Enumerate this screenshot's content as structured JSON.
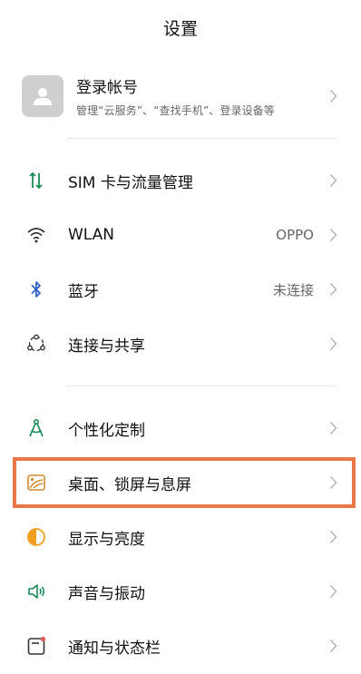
{
  "header": {
    "title": "设置"
  },
  "account": {
    "name": "登录帐号",
    "subtitle": "管理“云服务”、“查找手机”、登录设备等"
  },
  "groups": [
    [
      {
        "label": "SIM 卡与流量管理",
        "icon": "sim-icon"
      },
      {
        "label": "WLAN",
        "icon": "wifi-icon",
        "value": "OPPO"
      },
      {
        "label": "蓝牙",
        "icon": "bluetooth-icon",
        "value": "未连接"
      },
      {
        "label": "连接与共享",
        "icon": "share-icon"
      }
    ],
    [
      {
        "label": "个性化定制",
        "icon": "personalize-icon"
      },
      {
        "label": "桌面、锁屏与息屏",
        "icon": "wallpaper-icon",
        "highlighted": true
      },
      {
        "label": "显示与亮度",
        "icon": "brightness-icon"
      },
      {
        "label": "声音与振动",
        "icon": "sound-icon"
      },
      {
        "label": "通知与状态栏",
        "icon": "notification-icon"
      }
    ]
  ],
  "colors": {
    "accent_green": "#1a8a55",
    "bluetooth_blue": "#2b5fc7",
    "wallpaper_orange": "#d18b2f",
    "brightness_orange": "#f0a020",
    "notification_red": "#e05a5a",
    "highlight_border": "#e8784a"
  }
}
